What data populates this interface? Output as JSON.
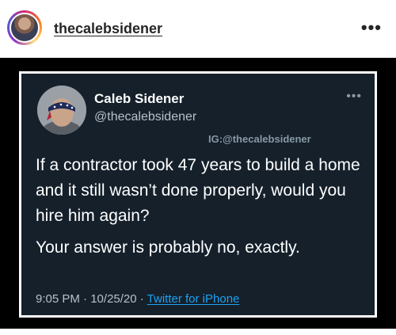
{
  "instagram": {
    "username": "thecalebsidener",
    "more_icon": "more-horizontal-icon",
    "more_glyph": "•••"
  },
  "tweet": {
    "display_name": "Caleb Sidener",
    "handle": "@thecalebsidener",
    "more_glyph": "•••",
    "watermark": "IG:@thecalebsidener",
    "paragraphs": [
      "If a contractor took 47 years to build a home and it still wasn’t done properly, would you hire him again?",
      "Your answer is probably no, exactly."
    ],
    "time": "9:05 PM",
    "separator": " · ",
    "date": "10/25/20",
    "source": "Twitter for iPhone",
    "background_color": "#15202b",
    "link_color": "#1da1f2"
  }
}
